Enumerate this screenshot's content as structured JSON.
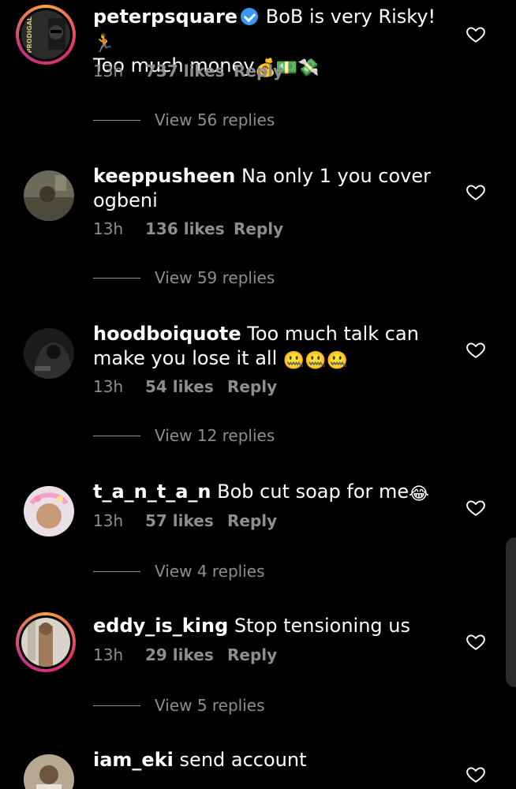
{
  "comments": [
    {
      "username": "peterpsquare",
      "verified": true,
      "text": "BoB is very Risky!",
      "emojis": [
        "🏃",
        "💰",
        "💵",
        "💸"
      ],
      "text_line2": "Too much money",
      "time": "13h",
      "likes": "737 likes",
      "reply": "Reply",
      "view_replies": "View 56 replies",
      "avatar_ring": true,
      "avatar_text": "PRODIGAL"
    },
    {
      "username": "keeppusheen",
      "verified": false,
      "text": "Na only 1 you cover ogbeni",
      "time": "13h",
      "likes": "136 likes",
      "reply": "Reply",
      "view_replies": "View 59 replies",
      "avatar_ring": false
    },
    {
      "username": "hoodboiquote",
      "verified": false,
      "text": "Too much talk can make you lose it all",
      "emojis": [
        "🤐",
        "🤐",
        "🤐"
      ],
      "time": "13h",
      "likes": "54 likes",
      "reply": "Reply",
      "view_replies": "View 12 replies",
      "avatar_ring": false
    },
    {
      "username": "t_a_n_t_a_n",
      "verified": false,
      "text": "Bob cut soap for me",
      "emojis": [
        "😂"
      ],
      "time": "13h",
      "likes": "57 likes",
      "reply": "Reply",
      "view_replies": "View 4 replies",
      "avatar_ring": false
    },
    {
      "username": "eddy_is_king",
      "verified": false,
      "text": "Stop tensioning us",
      "time": "13h",
      "likes": "29 likes",
      "reply": "Reply",
      "view_replies": "View 5 replies",
      "avatar_ring": true
    },
    {
      "username": "iam_eki",
      "verified": false,
      "text": "send account",
      "avatar_ring": false
    }
  ],
  "icons": {
    "like": "heart-outline-icon",
    "verified": "verified-badge-icon"
  },
  "colors": {
    "background": "#000000",
    "text": "#ffffff",
    "meta": "#8e8e8e",
    "verified": "#3897f0"
  }
}
